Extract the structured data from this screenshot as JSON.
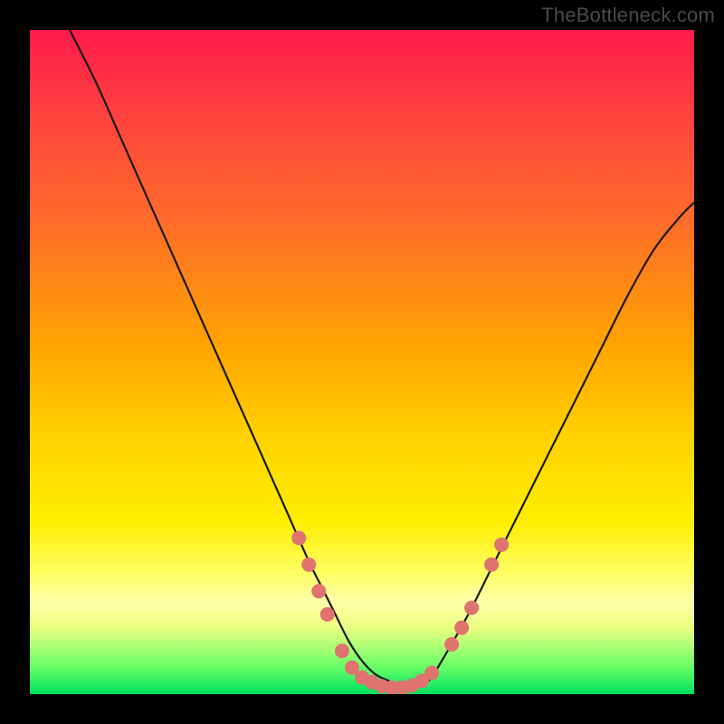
{
  "watermark": "TheBottleneck.com",
  "chart_data": {
    "type": "line",
    "title": "",
    "xlabel": "",
    "ylabel": "",
    "xlim": [
      0,
      100
    ],
    "ylim": [
      0,
      100
    ],
    "grid": false,
    "legend": false,
    "background_gradient": {
      "direction": "vertical",
      "stops": [
        {
          "pos": 0.0,
          "color": "#ff1a4a"
        },
        {
          "pos": 0.12,
          "color": "#ff4040"
        },
        {
          "pos": 0.28,
          "color": "#ff6a2a"
        },
        {
          "pos": 0.48,
          "color": "#ffa500"
        },
        {
          "pos": 0.62,
          "color": "#ffd400"
        },
        {
          "pos": 0.74,
          "color": "#ffee00"
        },
        {
          "pos": 0.82,
          "color": "#ffff66"
        },
        {
          "pos": 0.86,
          "color": "#ffffaa"
        },
        {
          "pos": 0.9,
          "color": "#eaff80"
        },
        {
          "pos": 0.96,
          "color": "#66ff66"
        },
        {
          "pos": 1.0,
          "color": "#00e060"
        }
      ]
    },
    "series": [
      {
        "name": "bottleneck-curve",
        "x": [
          6,
          10,
          14,
          18,
          22,
          26,
          30,
          34,
          38,
          42,
          44,
          46,
          48,
          50,
          52,
          54,
          56,
          58,
          60,
          62,
          66,
          70,
          74,
          78,
          82,
          86,
          90,
          94,
          98,
          100
        ],
        "y": [
          100,
          92,
          83,
          74,
          65,
          56,
          47,
          38,
          29,
          20,
          16,
          12,
          8,
          5,
          3,
          2,
          1,
          1,
          2,
          5,
          12,
          20,
          28,
          36,
          44,
          52,
          60,
          67,
          72,
          74
        ]
      }
    ],
    "markers": [
      {
        "name": "marker",
        "x": 40.5,
        "y": 23.5
      },
      {
        "name": "marker",
        "x": 42.0,
        "y": 19.5
      },
      {
        "name": "marker",
        "x": 43.5,
        "y": 15.5
      },
      {
        "name": "marker",
        "x": 44.8,
        "y": 12.0
      },
      {
        "name": "marker",
        "x": 47.0,
        "y": 6.5
      },
      {
        "name": "marker",
        "x": 48.5,
        "y": 4.0
      },
      {
        "name": "marker",
        "x": 50.0,
        "y": 2.5
      },
      {
        "name": "marker",
        "x": 51.5,
        "y": 1.8
      },
      {
        "name": "marker",
        "x": 53.0,
        "y": 1.2
      },
      {
        "name": "marker",
        "x": 54.5,
        "y": 1.0
      },
      {
        "name": "marker",
        "x": 56.0,
        "y": 1.0
      },
      {
        "name": "marker",
        "x": 57.5,
        "y": 1.3
      },
      {
        "name": "marker",
        "x": 59.0,
        "y": 2.0
      },
      {
        "name": "marker",
        "x": 60.5,
        "y": 3.2
      },
      {
        "name": "marker",
        "x": 63.5,
        "y": 7.5
      },
      {
        "name": "marker",
        "x": 65.0,
        "y": 10.0
      },
      {
        "name": "marker",
        "x": 66.5,
        "y": 13.0
      },
      {
        "name": "marker",
        "x": 69.5,
        "y": 19.5
      },
      {
        "name": "marker",
        "x": 71.0,
        "y": 22.5
      }
    ],
    "marker_style": {
      "color": "#e0736f",
      "radius_px": 8
    }
  }
}
